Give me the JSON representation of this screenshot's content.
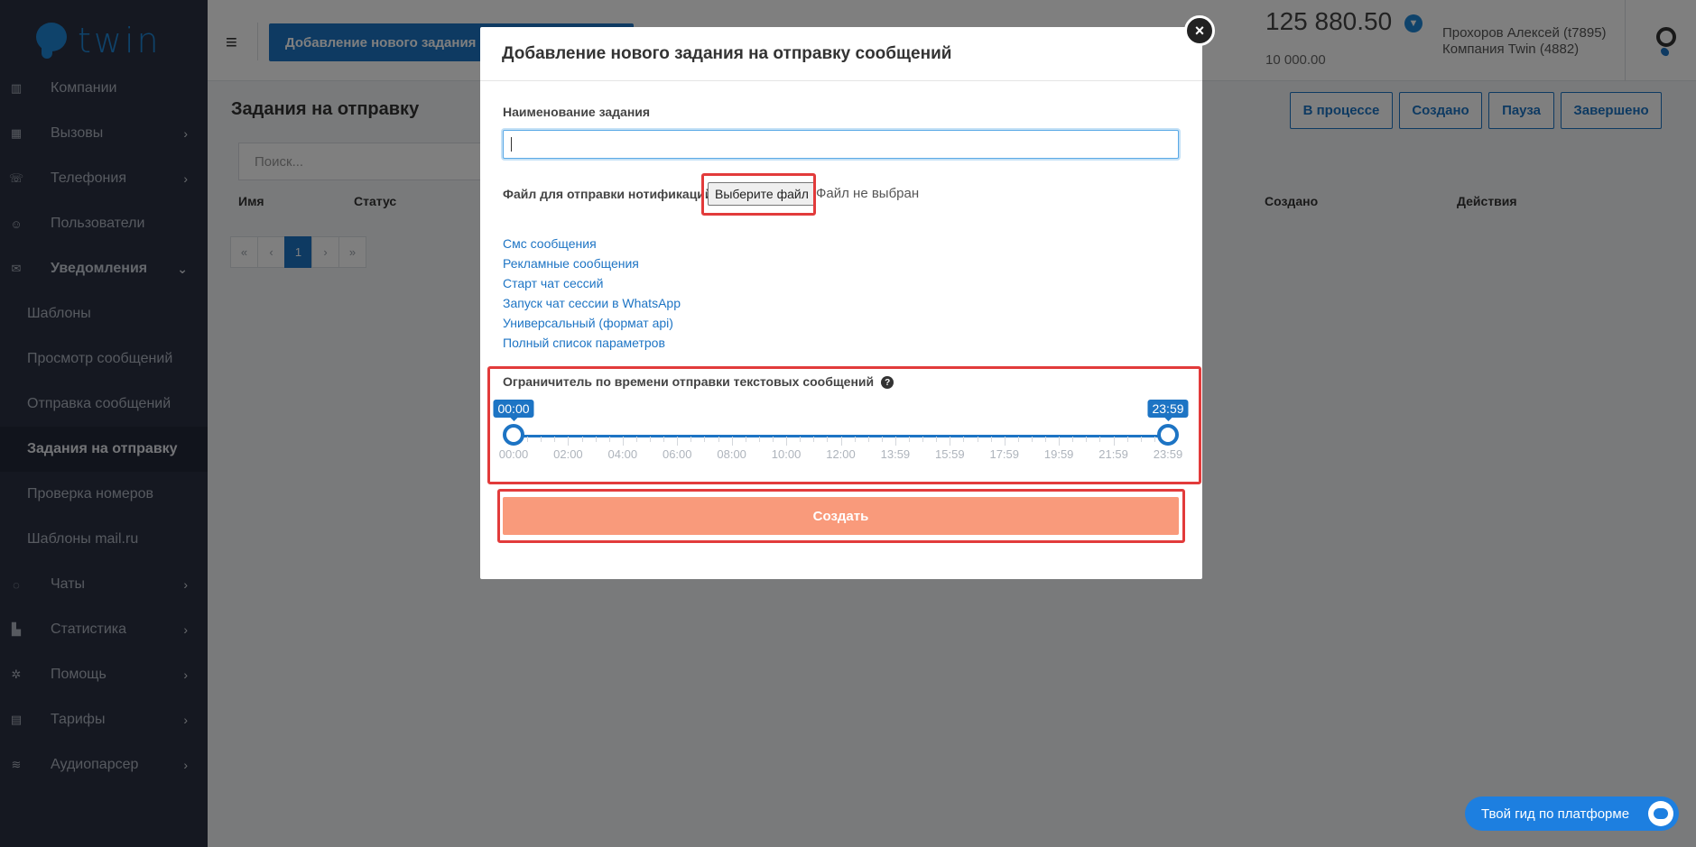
{
  "brand": {
    "logo_text": "twin"
  },
  "sidebar": {
    "items": [
      {
        "label": "Компании",
        "icon": "building-icon",
        "has_chevron": false
      },
      {
        "label": "Вызовы",
        "icon": "calendar-icon",
        "has_chevron": true
      },
      {
        "label": "Телефония",
        "icon": "phone-icon",
        "has_chevron": true
      },
      {
        "label": "Пользователи",
        "icon": "users-icon",
        "has_chevron": false
      },
      {
        "label": "Уведомления",
        "icon": "envelope-icon",
        "has_chevron": true,
        "expanded": true
      }
    ],
    "sub_items": [
      {
        "label": "Шаблоны"
      },
      {
        "label": "Просмотр сообщений"
      },
      {
        "label": "Отправка сообщений"
      },
      {
        "label": "Задания на отправку",
        "active": true
      },
      {
        "label": "Проверка номеров"
      },
      {
        "label": "Шаблоны mail.ru"
      }
    ],
    "bottom_items": [
      {
        "label": "Чаты",
        "icon": "chat-icon"
      },
      {
        "label": "Статистика",
        "icon": "bar-chart-icon"
      },
      {
        "label": "Помощь",
        "icon": "gears-icon"
      },
      {
        "label": "Тарифы",
        "icon": "calculator-icon"
      },
      {
        "label": "Аудиопарсер",
        "icon": "audio-wave-icon"
      }
    ]
  },
  "header": {
    "add_button_label": "Добавление нового задания на",
    "balance": "125 880.50",
    "balance_sub": "10 000.00",
    "user_name": "Прохоров Алексей (t7895)",
    "company": "Компания Twin (4882)"
  },
  "page": {
    "title": "Задания на отправку",
    "filters": [
      "В процессе",
      "Создано",
      "Пауза",
      "Завершено"
    ],
    "search_placeholder": "Поиск...",
    "columns": [
      "Имя",
      "Статус",
      "Создано",
      "Действия"
    ],
    "pager": [
      "«",
      "‹",
      "1",
      "›",
      "»"
    ],
    "current_page": "1"
  },
  "modal": {
    "title": "Добавление нового задания на отправку сообщений",
    "close_label": "×",
    "name_label": "Наименование задания",
    "name_value": "",
    "file_label": "Файл для отправки нотификаций",
    "file_button": "Выберите файл",
    "file_status": "Файл не выбран",
    "links": [
      "Смс сообщения",
      "Рекламные сообщения",
      "Старт чат сессий",
      "Запуск чат сессии в WhatsApp",
      "Универсальный (формат api)",
      "Полный список параметров"
    ],
    "limiter_label": "Ограничитель по времени отправки текстовых сообщений",
    "slider": {
      "from": "00:00",
      "to": "23:59",
      "ticks": [
        "00:00",
        "02:00",
        "04:00",
        "06:00",
        "08:00",
        "10:00",
        "12:00",
        "13:59",
        "15:59",
        "17:59",
        "19:59",
        "21:59",
        "23:59"
      ],
      "from_fraction": 0,
      "to_fraction": 1
    },
    "create_label": "Создать"
  },
  "guide": {
    "label": "Твой гид по платформе"
  },
  "colors": {
    "primary": "#1d74c4",
    "sidebar_bg": "#2a3142",
    "create_button": "#f99a7b",
    "highlight": "#e23b3b"
  }
}
